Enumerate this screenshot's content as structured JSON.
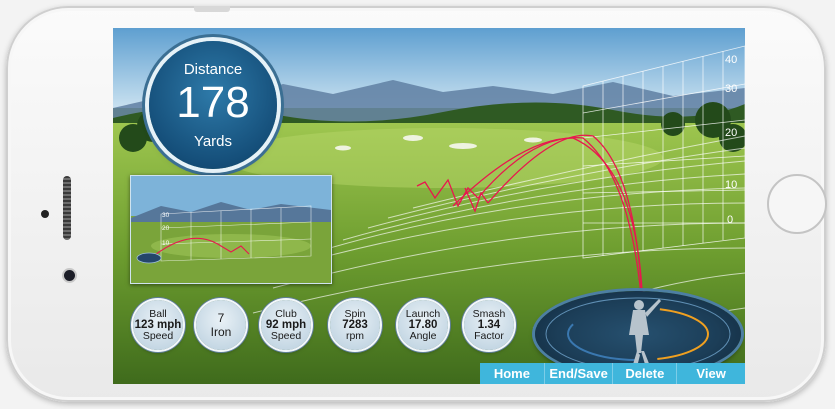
{
  "distance": {
    "label": "Distance",
    "value": "178",
    "unit": "Yards"
  },
  "grid_scale": [
    "40",
    "30",
    "20",
    "10",
    "0"
  ],
  "inset_scale": [
    "30",
    "20",
    "10"
  ],
  "stats": [
    {
      "top": "Ball",
      "mid": "123 mph",
      "bottom": "Speed"
    },
    {
      "top": "7",
      "mid": "Iron",
      "bottom": ""
    },
    {
      "top": "Club",
      "mid": "92 mph",
      "bottom": "Speed"
    },
    {
      "top": "Spin",
      "mid": "7283",
      "bottom": "rpm"
    },
    {
      "top": "Launch",
      "mid": "17.80",
      "bottom": "Angle"
    },
    {
      "top": "Smash",
      "mid": "1.34",
      "bottom": "Factor"
    }
  ],
  "toolbar": {
    "home": "Home",
    "end_save": "End/Save",
    "delete": "Delete",
    "view": "View"
  },
  "colors": {
    "trajectory": "#e8174e",
    "toolbar": "#3fb6dc",
    "badge": "#154f7a"
  }
}
